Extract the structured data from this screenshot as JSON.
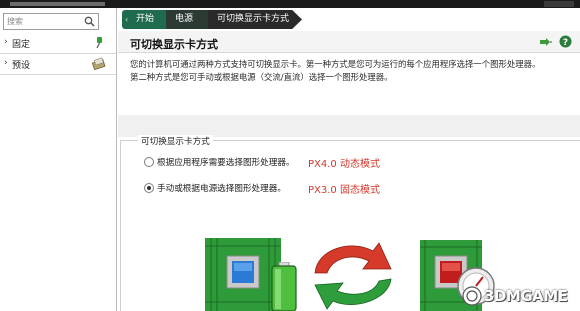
{
  "sidebar": {
    "search_placeholder": "搜索",
    "items": [
      {
        "label": "固定",
        "icon": "pin-icon"
      },
      {
        "label": "预设",
        "icon": "preset-icon"
      }
    ]
  },
  "breadcrumb": [
    "开始",
    "电源",
    "可切换显示卡方式"
  ],
  "header": {
    "title": "可切换显示卡方式",
    "icons": [
      "pin-icon",
      "help-icon"
    ]
  },
  "description": [
    "您的计算机可通过两种方式支持可切换显示卡。第一种方式是您可为运行的每个应用程序选择一个图形处理器。",
    "第二种方式是您可手动或根据电源（交流/直流）选择一个图形处理器。"
  ],
  "group": {
    "label": "可切换显示卡方式",
    "options": [
      {
        "label": "根据应用程序需要选择图形处理器。",
        "mode": "PX4.0 动态模式",
        "selected": false
      },
      {
        "label": "手动或根据电源选择图形处理器。",
        "mode": "PX3.0 固态模式",
        "selected": true
      }
    ]
  },
  "watermark": "3DMGAME",
  "colors": {
    "crumb_active": "#1e6b4d",
    "mode_text": "#d33a2c",
    "chip_green": "#2f9a3a",
    "arrow_red": "#d63a2a",
    "arrow_green": "#2e9d3c"
  }
}
